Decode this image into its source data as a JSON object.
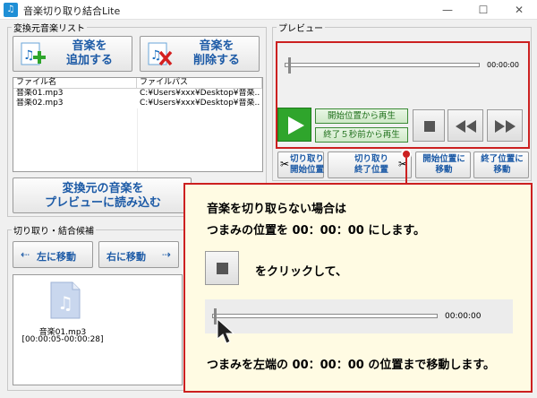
{
  "window": {
    "title": "音楽切り取り結合Lite",
    "minimize": "—",
    "maximize": "☐",
    "close": "✕"
  },
  "source_group": {
    "label": "変換元音楽リスト",
    "add_button_label": "音楽を\n追加する",
    "delete_button_label": "音楽を\n削除する",
    "table": {
      "columns": [
        "ファイル名",
        "ファイルパス"
      ],
      "rows": [
        [
          "音楽01.mp3",
          "C:¥Users¥xxx¥Desktop¥音楽..."
        ],
        [
          "音楽02.mp3",
          "C:¥Users¥xxx¥Desktop¥音楽..."
        ]
      ]
    },
    "load_preview_label": "変換元の音楽を\nプレビューに読み込む"
  },
  "preview_group": {
    "label": "プレビュー",
    "time": "00:00:00",
    "play_from_start": "開始位置から再生",
    "play_5s_before_end": "終了５秒前から再生",
    "cut_start": "切り取り\n開始位置",
    "cut_end": "切り取り\n終了位置",
    "move_to_start": "開始位置に\n移動",
    "move_to_end": "終了位置に\n移動"
  },
  "candidates_group": {
    "label": "切り取り・結合候補",
    "move_left": "左に移動",
    "move_right": "右に移動",
    "item": {
      "name": "音楽01.mp3",
      "range": "[00:00:05-00:00:28]"
    }
  },
  "callout": {
    "line1": "音楽を切り取らない場合は",
    "line2": "つまみの位置を 00：00：00 にします。",
    "line3": "をクリックして、",
    "time": "00:00:00",
    "line4": "つまみを左端の 00：00：00 の位置まで移動します。"
  },
  "colors": {
    "accent_red": "#cc2020",
    "green": "#2fa52c",
    "button_text_blue": "#1c5aa6"
  }
}
